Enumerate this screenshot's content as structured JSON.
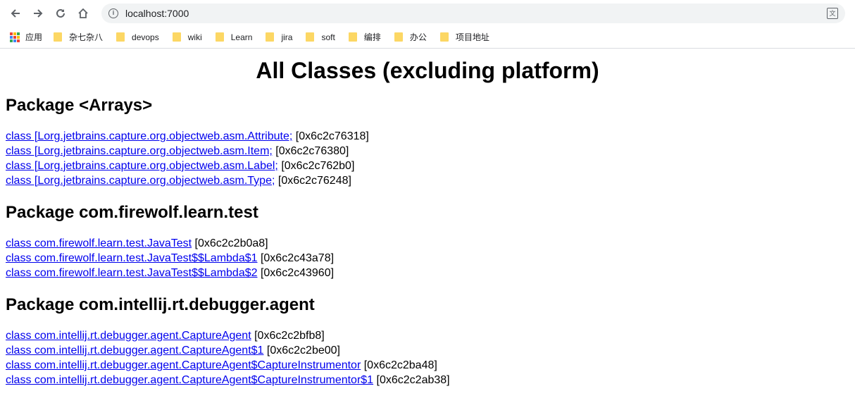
{
  "browser": {
    "url": "localhost:7000",
    "bookmarks": [
      {
        "label": "应用",
        "type": "apps"
      },
      {
        "label": "杂七杂八",
        "type": "folder"
      },
      {
        "label": "devops",
        "type": "folder"
      },
      {
        "label": "wiki",
        "type": "folder"
      },
      {
        "label": "Learn",
        "type": "folder"
      },
      {
        "label": "jira",
        "type": "folder"
      },
      {
        "label": "soft",
        "type": "folder"
      },
      {
        "label": "编排",
        "type": "folder"
      },
      {
        "label": "办公",
        "type": "folder"
      },
      {
        "label": "项目地址",
        "type": "folder"
      }
    ]
  },
  "page": {
    "title": "All Classes (excluding platform)",
    "packages": [
      {
        "name": "Package <Arrays>",
        "classes": [
          {
            "link": "class [Lorg.jetbrains.capture.org.objectweb.asm.Attribute;",
            "addr": " [0x6c2c76318]"
          },
          {
            "link": "class [Lorg.jetbrains.capture.org.objectweb.asm.Item;",
            "addr": " [0x6c2c76380]"
          },
          {
            "link": "class [Lorg.jetbrains.capture.org.objectweb.asm.Label;",
            "addr": " [0x6c2c762b0]"
          },
          {
            "link": "class [Lorg.jetbrains.capture.org.objectweb.asm.Type;",
            "addr": " [0x6c2c76248]"
          }
        ]
      },
      {
        "name": "Package com.firewolf.learn.test",
        "classes": [
          {
            "link": "class com.firewolf.learn.test.JavaTest",
            "addr": " [0x6c2c2b0a8]"
          },
          {
            "link": "class com.firewolf.learn.test.JavaTest$$Lambda$1",
            "addr": " [0x6c2c43a78]"
          },
          {
            "link": "class com.firewolf.learn.test.JavaTest$$Lambda$2",
            "addr": " [0x6c2c43960]"
          }
        ]
      },
      {
        "name": "Package com.intellij.rt.debugger.agent",
        "classes": [
          {
            "link": "class com.intellij.rt.debugger.agent.CaptureAgent",
            "addr": " [0x6c2c2bfb8]"
          },
          {
            "link": "class com.intellij.rt.debugger.agent.CaptureAgent$1",
            "addr": " [0x6c2c2be00]"
          },
          {
            "link": "class com.intellij.rt.debugger.agent.CaptureAgent$CaptureInstrumentor",
            "addr": " [0x6c2c2ba48]"
          },
          {
            "link": "class com.intellij.rt.debugger.agent.CaptureAgent$CaptureInstrumentor$1",
            "addr": " [0x6c2c2ab38]"
          }
        ]
      }
    ]
  },
  "colors": {
    "link": "#0000ee",
    "folder": "#fcd764",
    "apps_grid": [
      "#ea4335",
      "#fbbc05",
      "#34a853",
      "#4285f4",
      "#ea4335",
      "#fbbc05",
      "#34a853",
      "#4285f4",
      "#ea4335"
    ]
  }
}
